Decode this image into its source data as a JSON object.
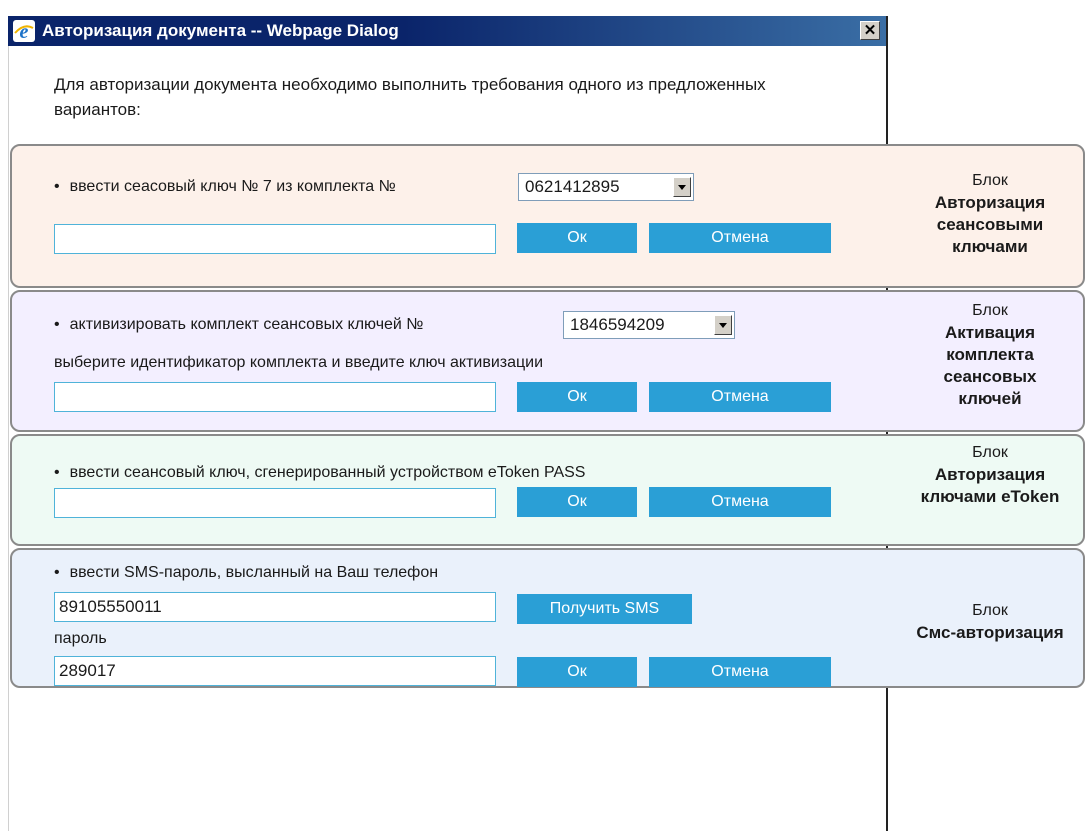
{
  "window": {
    "title": "Авторизация документа -- Webpage Dialog",
    "close_glyph": "✕"
  },
  "intro": "Для авторизации документа необходимо выполнить требования одного из предложенных вариантов:",
  "block_session": {
    "instruction": "ввести сеасовый ключ № 7 из комплекта №",
    "set_select": "0621412895",
    "key_input": "",
    "ok_label": "Ок",
    "cancel_label": "Отмена",
    "side_prefix": "Блок",
    "side_title": "Авторизация сеансовыми ключами"
  },
  "block_activation": {
    "instruction": "активизировать комплект сеансовых ключей №",
    "set_select": "1846594209",
    "hint": "выберите идентификатор комплекта и введите ключ активизации",
    "key_input": "",
    "ok_label": "Ок",
    "cancel_label": "Отмена",
    "side_prefix": "Блок",
    "side_title": "Активация комплекта сеансовых ключей"
  },
  "block_etoken": {
    "instruction": "ввести сеансовый ключ, сгенерированный устройством eToken PASS",
    "key_input": "",
    "ok_label": "Ок",
    "cancel_label": "Отмена",
    "side_prefix": "Блок",
    "side_title": "Авторизация ключами eToken"
  },
  "block_sms": {
    "instruction": "ввести SMS-пароль, высланный на Ваш телефон",
    "phone_input": "89105550011",
    "get_sms_label": "Получить SMS",
    "password_label": "пароль",
    "password_input": "289017",
    "ok_label": "Ок",
    "cancel_label": "Отмена",
    "side_prefix": "Блок",
    "side_title": "Смс-авторизация"
  },
  "colors": {
    "button": "#2a9fd6",
    "titlebar": "#0a246a",
    "block_session_bg": "#fdf1ea",
    "block_activation_bg": "#f3efff",
    "block_etoken_bg": "#eefaf4",
    "block_sms_bg": "#eaf1fb"
  },
  "icons": {
    "app_icon": "internet-explorer-icon",
    "close_icon": "close-icon",
    "dropdown_icon": "chevron-down-icon"
  }
}
